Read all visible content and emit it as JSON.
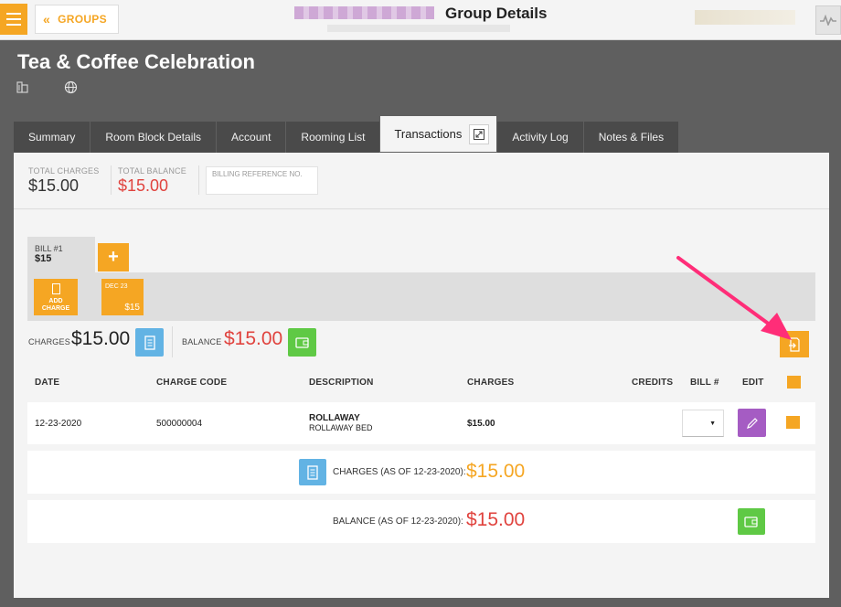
{
  "topbar": {
    "groups_label": "GROUPS",
    "title": "Group Details"
  },
  "group": {
    "name": "Tea & Coffee Celebration"
  },
  "tabs": [
    {
      "label": "Summary"
    },
    {
      "label": "Room Block Details"
    },
    {
      "label": "Account"
    },
    {
      "label": "Rooming List"
    },
    {
      "label": "Transactions",
      "active": true
    },
    {
      "label": "Activity Log"
    },
    {
      "label": "Notes & Files"
    }
  ],
  "summary": {
    "total_charges_label": "TOTAL CHARGES",
    "total_charges_value": "$15.00",
    "total_balance_label": "TOTAL BALANCE",
    "total_balance_value": "$15.00",
    "billing_ref_label": "BILLING REFERENCE NO.",
    "billing_ref_value": ""
  },
  "bill": {
    "label": "BILL #1",
    "value": "$15",
    "add_bill_symbol": "+",
    "add_charge_label_1": "ADD",
    "add_charge_label_2": "CHARGE",
    "date_tile_date": "DEC 23",
    "date_tile_amount": "$15"
  },
  "charges_line": {
    "charges_label": "CHARGES",
    "charges_value": "$15.00",
    "balance_label": "BALANCE",
    "balance_value": "$15.00"
  },
  "table": {
    "headers": {
      "date": "DATE",
      "charge_code": "CHARGE CODE",
      "description": "DESCRIPTION",
      "charges": "CHARGES",
      "credits": "CREDITS",
      "bill": "BILL #",
      "edit": "EDIT"
    },
    "rows": [
      {
        "date": "12-23-2020",
        "charge_code": "500000004",
        "description_title": "ROLLAWAY",
        "description_sub": "ROLLAWAY BED",
        "charges": "$15.00",
        "credits": "",
        "bill_selected": ""
      }
    ]
  },
  "totals": {
    "charges_label": "CHARGES (AS OF 12-23-2020):",
    "charges_value": "$15.00",
    "balance_label": "BALANCE (AS OF 12-23-2020):",
    "balance_value": "$15.00"
  },
  "colors": {
    "accent": "#f5a623",
    "red": "#e0433e",
    "annotation_arrow": "#ff2d78"
  }
}
